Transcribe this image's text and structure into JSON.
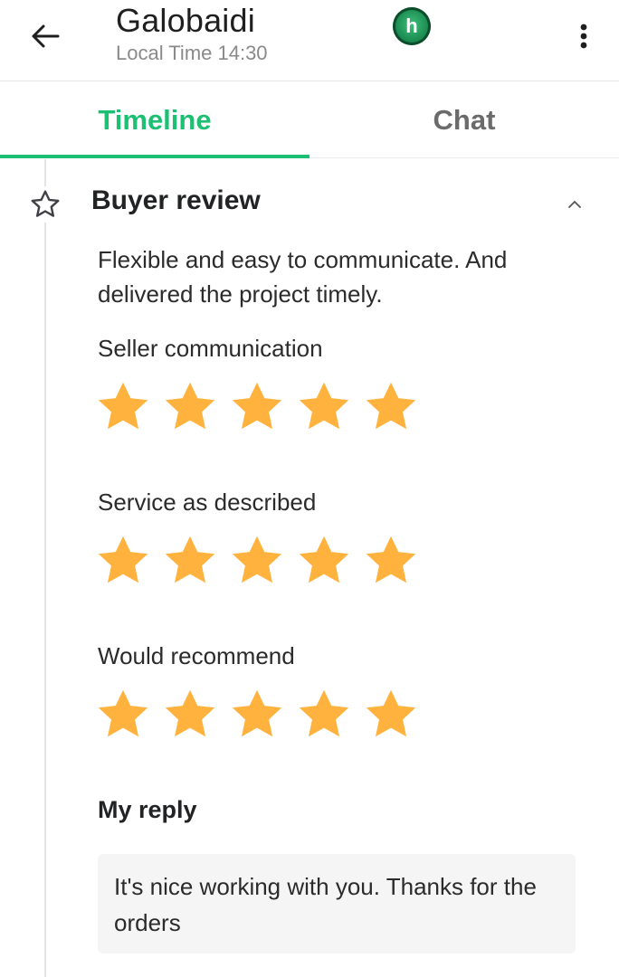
{
  "header": {
    "name": "Galobaidi",
    "local_time": "Local Time 14:30",
    "avatar_letter": "h"
  },
  "tabs": [
    {
      "label": "Timeline",
      "active": true
    },
    {
      "label": "Chat",
      "active": false
    }
  ],
  "review": {
    "title": "Buyer review",
    "text": "Flexible and easy to communicate. And delivered the project timely.",
    "ratings": [
      {
        "label": "Seller communication",
        "stars": 5
      },
      {
        "label": "Service as described",
        "stars": 5
      },
      {
        "label": "Would recommend",
        "stars": 5
      }
    ],
    "reply_title": "My reply",
    "reply_text": "It's nice working with you. Thanks for the orders"
  },
  "colors": {
    "accent": "#1dbf73",
    "star": "#ffb33e",
    "tab_inactive": "#6b6b6b"
  },
  "icons": {
    "back": "arrow-left-icon",
    "more": "more-vertical-icon",
    "timeline_marker": "star-outline-icon",
    "collapse": "chevron-up-icon",
    "rating_star": "star-filled-icon"
  }
}
